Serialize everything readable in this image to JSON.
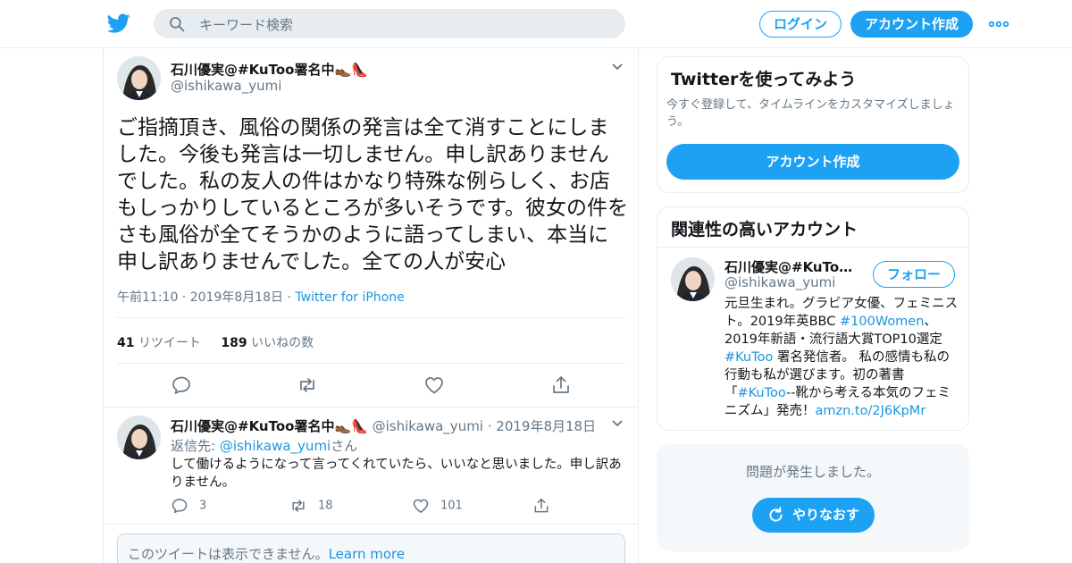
{
  "header": {
    "search_placeholder": "キーワード検索",
    "login_label": "ログイン",
    "signup_label": "アカウント作成",
    "brand_color": "#1da1f2"
  },
  "tweet": {
    "author_name": "石川優実@#KuToo署名中👞👠",
    "author_handle": "@ishikawa_yumi",
    "text": "ご指摘頂き、風俗の関係の発言は全て消すことにしました。今後も発言は一切しません。申し訳ありませんでした。私の友人の件はかなり特殊な例らしく、お店もしっかりしているところが多いそうです。彼女の件をさも風俗が全てそうかのように語ってしまい、本当に申し訳ありませんでした。全ての人が安心",
    "timestamp": "午前11:10 · 2019年8月18日",
    "separator": " · ",
    "source": "Twitter for iPhone",
    "retweet_count": "41",
    "retweet_label": "リツイート",
    "like_count": "189",
    "like_label": "いいねの数"
  },
  "reply": {
    "author_name": "石川優実@#KuToo署名中👞👠",
    "meta": " @ishikawa_yumi · 2019年8月18日",
    "reply_prefix": "返信先: ",
    "reply_to": "@ishikawa_yumi",
    "reply_suffix": "さん",
    "text": "して働けるようになって言ってくれていたら、いいなと思いました。申し訳ありません。",
    "reply_count": "3",
    "retweet_count": "18",
    "like_count": "101"
  },
  "unavailable": {
    "text": "このツイートは表示できません。",
    "link": "Learn more"
  },
  "sidebar": {
    "signup_card": {
      "title": "Twitterを使ってみよう",
      "desc": "今すぐ登録して、タイムラインをカスタマイズしましょう。",
      "cta": "アカウント作成"
    },
    "related_card": {
      "title": "関連性の高いアカウント",
      "name": "石川優実@#KuToo署名中👞👠",
      "handle": "@ishikawa_yumi",
      "follow_label": "フォロー",
      "bio_1": "元旦生まれ。グラビア女優、フェミニスト。2019年英BBC ",
      "bio_tag1": "#100Women",
      "bio_2": "、2019年新語・流行語大賞TOP10選定",
      "bio_tag2": "#KuToo",
      "bio_3": " 署名発信者。 私の感情も私の行動も私が選びます。初の著書「",
      "bio_tag3": "#KuToo",
      "bio_4": "--靴から考える本気のフェミニズム」発売！",
      "bio_link": "amzn.to/2J6KpMr"
    },
    "error_card": {
      "message": "問題が発生しました。",
      "retry_label": "やりなおす"
    }
  }
}
